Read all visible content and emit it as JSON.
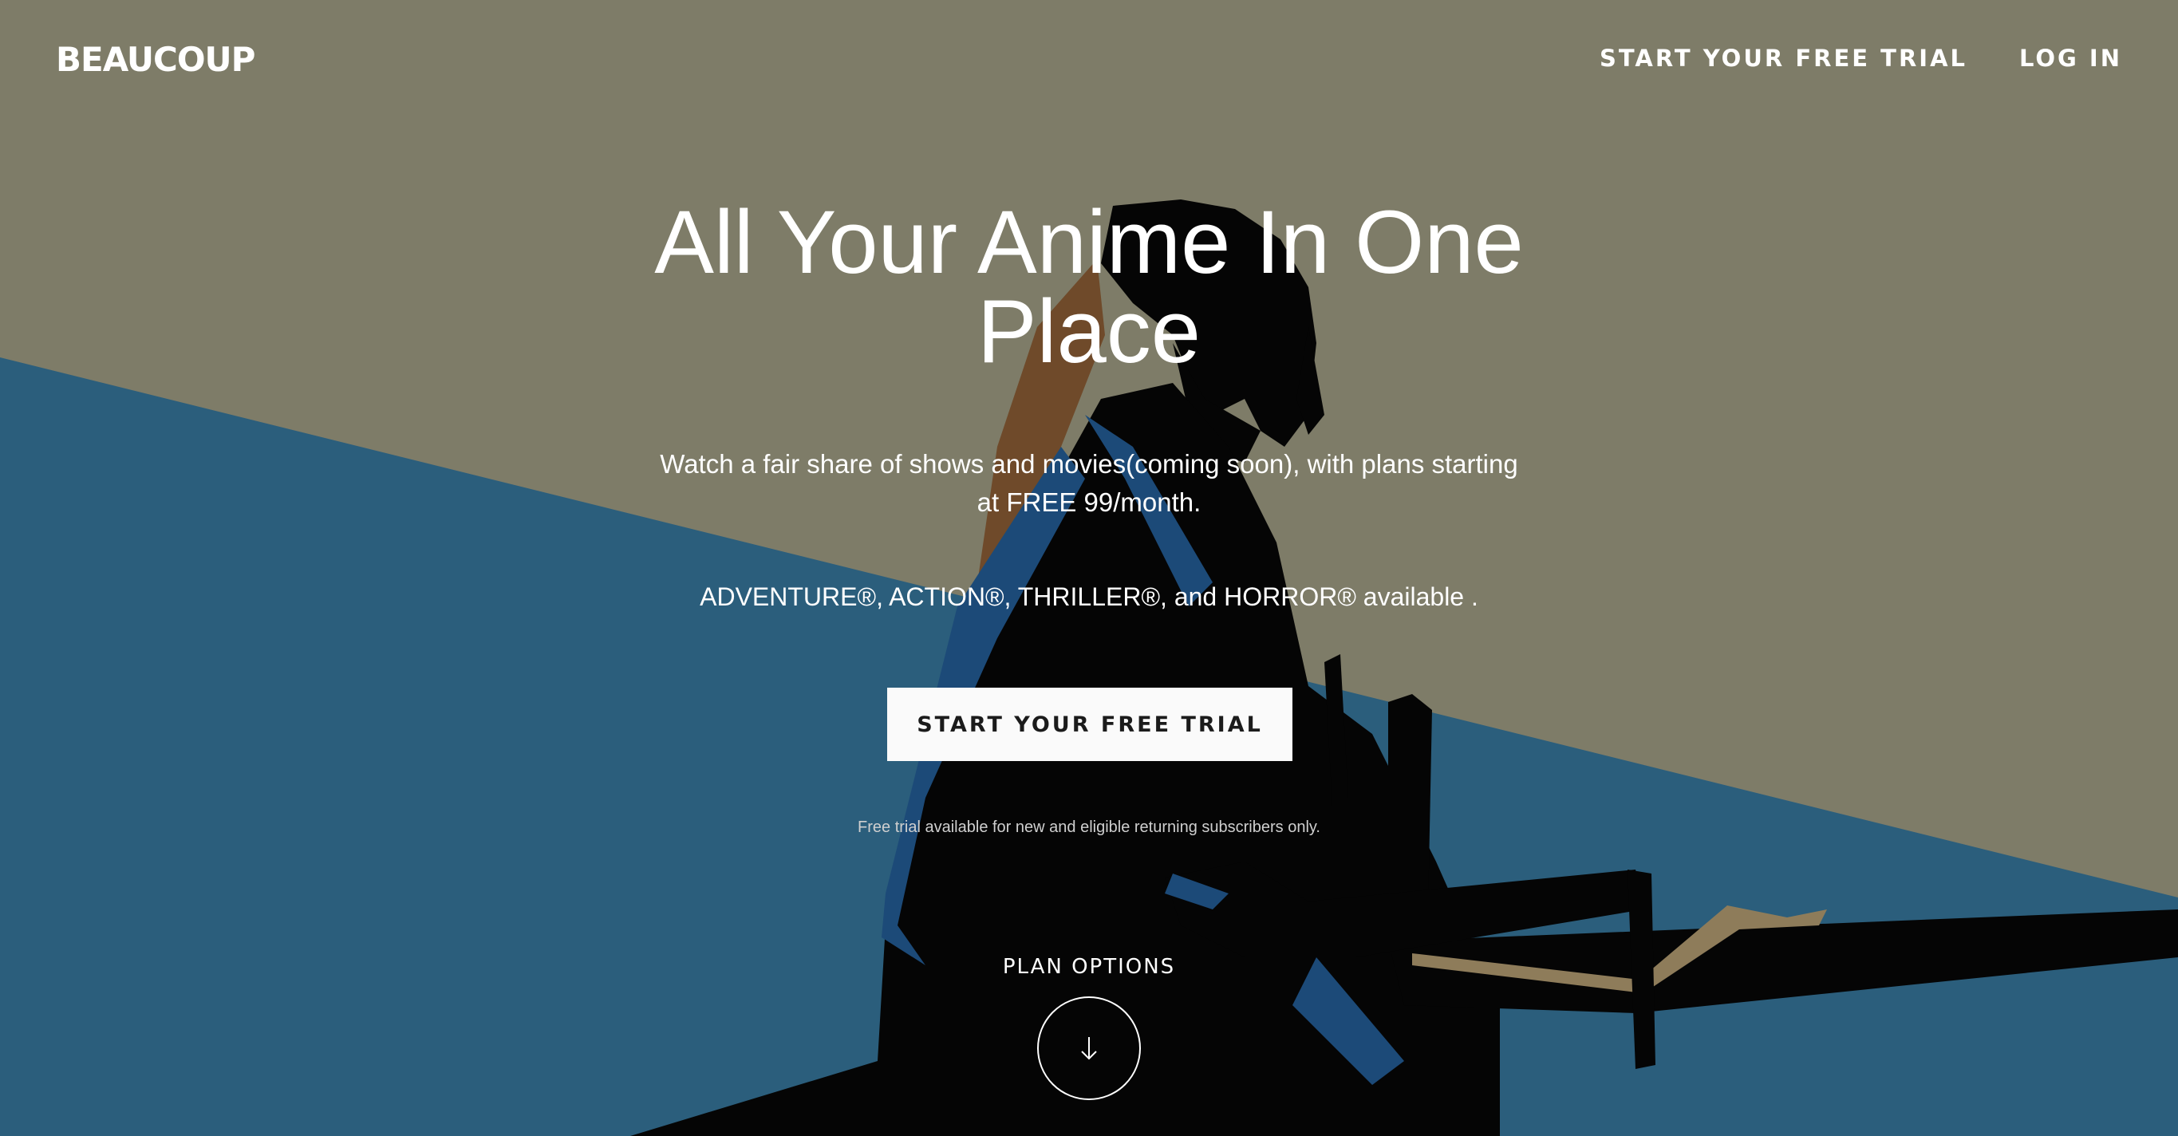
{
  "brand": {
    "logo_text": "BEAUCOUP"
  },
  "nav": {
    "trial_label": "START YOUR FREE TRIAL",
    "login_label": "LOG IN"
  },
  "hero": {
    "headline": "All Your Anime In One Place",
    "subtext": "Watch a fair share of shows and movies(coming soon), with plans starting at FREE 99/month.",
    "genres": "ADVENTURE®, ACTION®, THRILLER®, and HORROR® available .",
    "cta_label": "START YOUR FREE TRIAL",
    "disclaimer": "Free trial available for new and eligible returning subscribers only."
  },
  "plans": {
    "label": "PLAN OPTIONS",
    "scroll_icon": "arrow-down-icon"
  },
  "colors": {
    "background_olive": "#7e7c68",
    "background_blue": "#2b5e7c",
    "silhouette": "#050505",
    "accent_blue": "#1c4a78",
    "accent_brown": "#6f4a2a",
    "accent_tan": "#8e7c5a",
    "cta_background": "#fafafa",
    "cta_text": "#1b1b1b"
  }
}
